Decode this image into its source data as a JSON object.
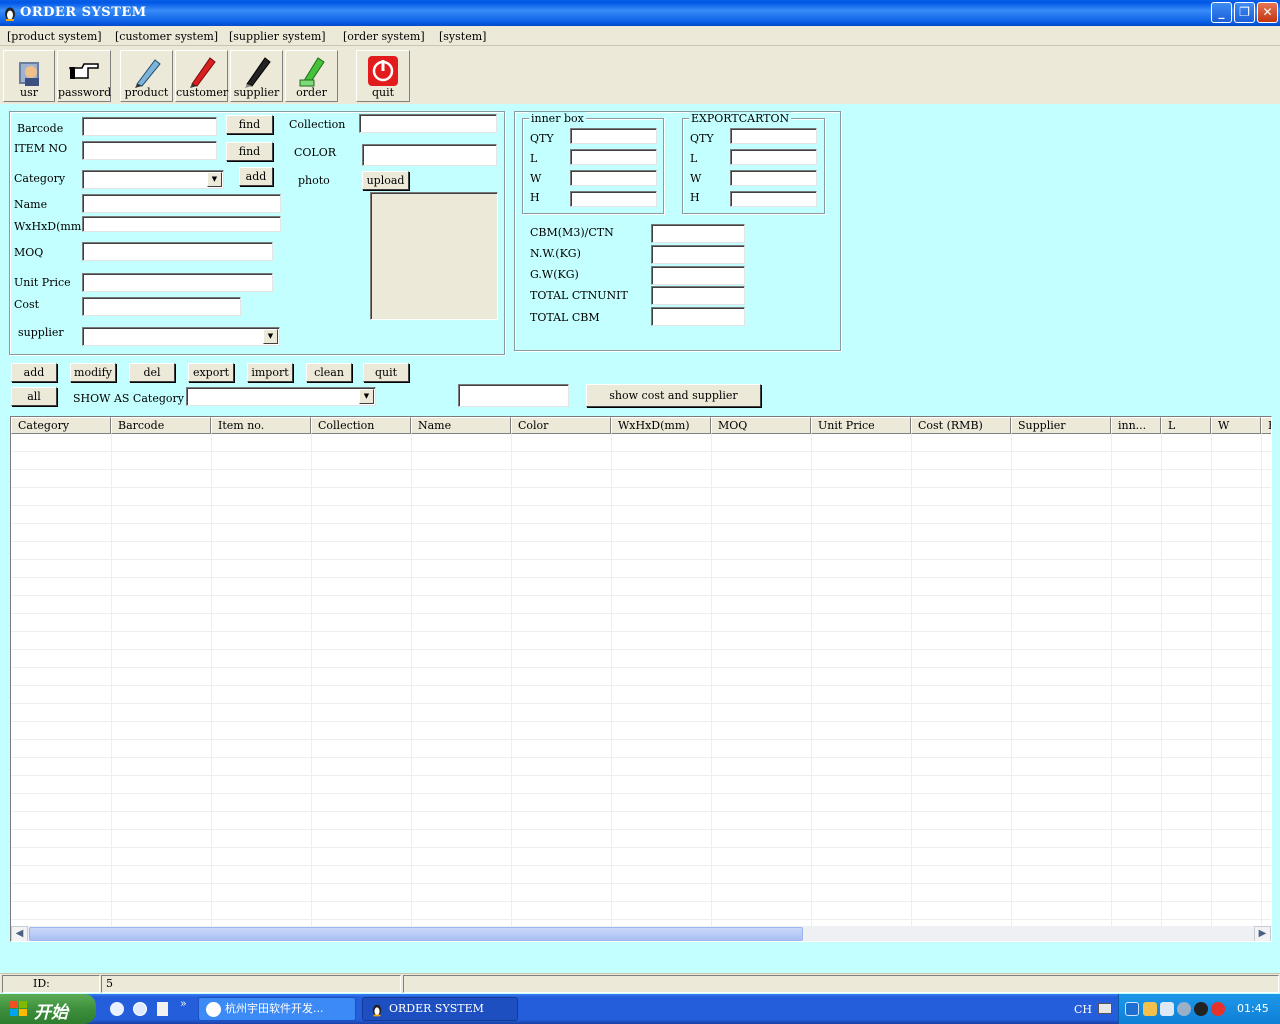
{
  "window": {
    "title": "ORDER SYSTEM"
  },
  "menu": [
    "[product system]",
    "[customer system]",
    "[supplier system]",
    "[order system]",
    "[system]"
  ],
  "toolbar": [
    {
      "label": "usr",
      "icon": "user-icon"
    },
    {
      "label": "password",
      "icon": "pointing-hand-icon"
    },
    {
      "label": "product",
      "icon": "pen-icon"
    },
    {
      "label": "customer",
      "icon": "red-pen-icon"
    },
    {
      "label": "supplier",
      "icon": "black-pen-icon"
    },
    {
      "label": "order",
      "icon": "green-pen-icon"
    },
    {
      "label": "quit",
      "icon": "power-icon"
    }
  ],
  "form": {
    "barcode_label": "Barcode",
    "itemno_label": "ITEM NO",
    "category_label": "Category",
    "name_label": "Name",
    "dims_label": "WxHxD(mm)",
    "moq_label": "MOQ",
    "unitprice_label": "Unit Price",
    "cost_label": "Cost",
    "supplier_label": "supplier",
    "collection_label": "Collection",
    "color_label": "COLOR",
    "photo_label": "photo",
    "find_label": "find",
    "add_label": "add",
    "upload_label": "upload"
  },
  "innerbox": {
    "title": "inner box",
    "qty": "QTY",
    "l": "L",
    "w": "W",
    "h": "H"
  },
  "exportcarton": {
    "title": "EXPORTCARTON",
    "qty": "QTY",
    "l": "L",
    "w": "W",
    "h": "H"
  },
  "metrics": {
    "cbm": "CBM(M3)/CTN",
    "nw": "N.W.(KG)",
    "gw": "G.W(KG)",
    "total_ctn": "TOTAL CTNUNIT",
    "total_cbm": "TOTAL CBM"
  },
  "actions": [
    "add",
    "modify",
    "del",
    "export",
    "import",
    "clean",
    "quit"
  ],
  "filter": {
    "all_label": "all",
    "show_as_label": "SHOW AS Category",
    "show_cost_label": "show cost and supplier"
  },
  "grid": {
    "columns": [
      "Category",
      "Barcode",
      "Item no.",
      "Collection",
      "Name",
      "Color",
      "WxHxD(mm)",
      "MOQ",
      "Unit Price",
      "Cost (RMB)",
      "Supplier",
      "inn...",
      "L",
      "W",
      "H"
    ]
  },
  "status": {
    "id_label": "ID:",
    "id_value": "5"
  },
  "taskbar": {
    "start": "开始",
    "tasks": [
      "杭州宇田软件开发...",
      "ORDER SYSTEM"
    ],
    "lang": "CH",
    "clock": "01:45"
  }
}
